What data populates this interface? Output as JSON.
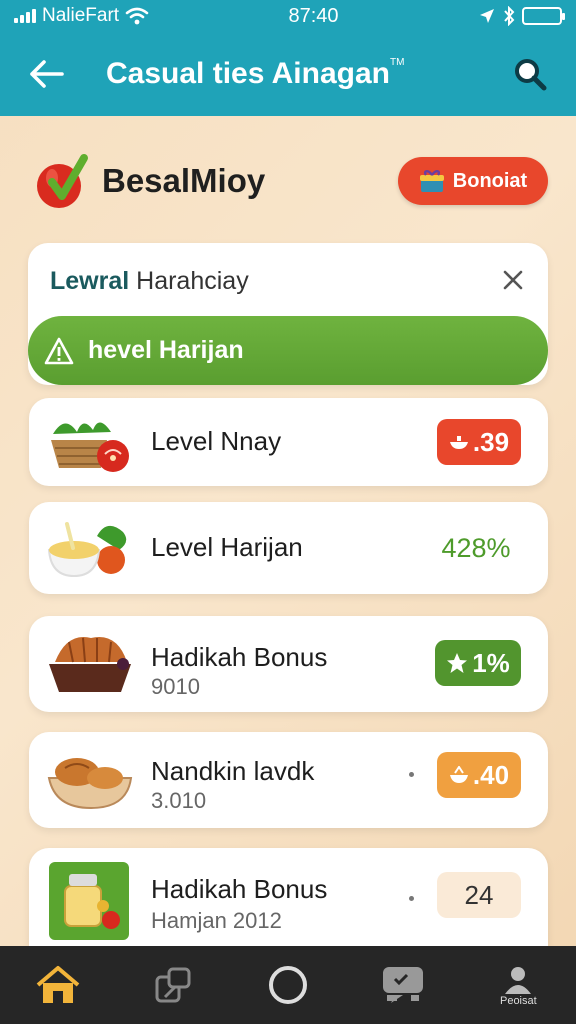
{
  "status_bar": {
    "carrier": "NalieFart",
    "time": "87:40",
    "icons": [
      "signal-icon",
      "wifi-icon",
      "location-icon",
      "bluetooth-icon",
      "battery-icon"
    ]
  },
  "app_bar": {
    "title": "Casual ties Ainagan",
    "title_mark": "TM",
    "back_icon": "arrow-left-icon",
    "search_icon": "search-icon"
  },
  "brand": {
    "name": "BesalMioy",
    "logo_icon": "apple-check-icon",
    "bonus_button": "Bonoiat",
    "bonus_icon": "gift-icon"
  },
  "header_card": {
    "title_bold": "Lewral",
    "title_rest": " Harahciay",
    "close_icon": "close-icon",
    "banner_text": "hevel Harijan",
    "banner_icon": "warning-icon"
  },
  "items": [
    {
      "title": "Level Nnay",
      "subtitle": "",
      "badge": ".39",
      "badge_icon": "bowl-icon",
      "thumb": "vegetable-basket"
    },
    {
      "title": "Level Harijan",
      "subtitle": "",
      "badge": "428%",
      "badge_icon": "",
      "thumb": "soup-bowl"
    },
    {
      "title": "Hadikah Bonus",
      "subtitle": "9010",
      "badge": "1%",
      "badge_icon": "star-icon",
      "thumb": "croissant-basket"
    },
    {
      "title": "Nandkin lavdk",
      "subtitle": "3.010",
      "badge": ".40",
      "badge_icon": "bowl-icon",
      "thumb": "bread-bowl"
    },
    {
      "title": "Hadikah Bonus",
      "subtitle": "Hamjan 2012",
      "badge": "24",
      "badge_icon": "",
      "thumb": "jar-card"
    }
  ],
  "bottom_nav": [
    {
      "label": "",
      "icon": "home-icon"
    },
    {
      "label": "",
      "icon": "share-icon"
    },
    {
      "label": "",
      "icon": "circle-icon"
    },
    {
      "label": "",
      "icon": "chat-icon"
    },
    {
      "label": "Peoisat",
      "icon": "profile-icon"
    }
  ],
  "colors": {
    "teal": "#1fa3b8",
    "background": "#f6dfc0",
    "red": "#e8472c",
    "green": "#5a9e30",
    "orange": "#f0a040",
    "nav": "#262626"
  }
}
